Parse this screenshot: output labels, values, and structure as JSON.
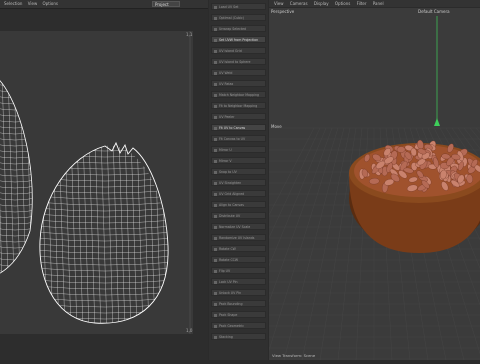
{
  "uv_editor": {
    "menu": [
      "Selection",
      "View",
      "Options"
    ],
    "mode_select": "Project",
    "corner_tr": "1,1",
    "corner_br": "1,0"
  },
  "palette": {
    "items": [
      {
        "label": "Load UV Set",
        "hl": false
      },
      {
        "label": "Optimal (Cubic)",
        "hl": false
      },
      {
        "label": "Unwrap Selected",
        "hl": false
      },
      {
        "label": "Set UVW from Projection",
        "hl": true
      },
      {
        "label": "UV Island Grid",
        "hl": false
      },
      {
        "label": "UV Island to Sphere",
        "hl": false
      },
      {
        "label": "UV Weld",
        "hl": false
      },
      {
        "label": "UV Relax",
        "hl": false
      },
      {
        "label": "Match Neighbor Mapping",
        "hl": false
      },
      {
        "label": "Fit to Neighbor Mapping",
        "hl": false
      },
      {
        "label": "UV Peeler",
        "hl": false
      },
      {
        "label": "Fit UV to Canvas",
        "hl": true
      },
      {
        "label": "Fit Canvas to UV",
        "hl": false
      },
      {
        "label": "Mirror U",
        "hl": false
      },
      {
        "label": "Mirror V",
        "hl": false
      },
      {
        "label": "Snap to UV",
        "hl": false
      },
      {
        "label": "UV Straighten",
        "hl": false
      },
      {
        "label": "UV Grid Aligned",
        "hl": false
      },
      {
        "label": "Align to Canvas",
        "hl": false
      },
      {
        "label": "Distribute UV",
        "hl": false
      },
      {
        "label": "Normalize UV Scale",
        "hl": false
      },
      {
        "label": "Randomize UV Islands",
        "hl": false
      },
      {
        "label": "Rotate CW",
        "hl": false
      },
      {
        "label": "Rotate CCW",
        "hl": false
      },
      {
        "label": "Flip UV",
        "hl": false
      },
      {
        "label": "Lock UV Pin",
        "hl": false
      },
      {
        "label": "Unlock UV Pin",
        "hl": false
      },
      {
        "label": "Pack Bounding",
        "hl": false
      },
      {
        "label": "Pack Shape",
        "hl": false
      },
      {
        "label": "Pack Geometric",
        "hl": false
      },
      {
        "label": "Stacking",
        "hl": false
      }
    ]
  },
  "viewport": {
    "menu": [
      "View",
      "Cameras",
      "Display",
      "Options",
      "Filter",
      "Panel"
    ],
    "title": "Perspective",
    "camera": "Default Camera",
    "move_label": "Move",
    "footer": "View Transform: Scene"
  },
  "colors": {
    "bowl": "#8a4a1e",
    "bowl_dark": "#5a2c10",
    "bean": "#c9826d",
    "axis_y": "#3ecf5a"
  }
}
